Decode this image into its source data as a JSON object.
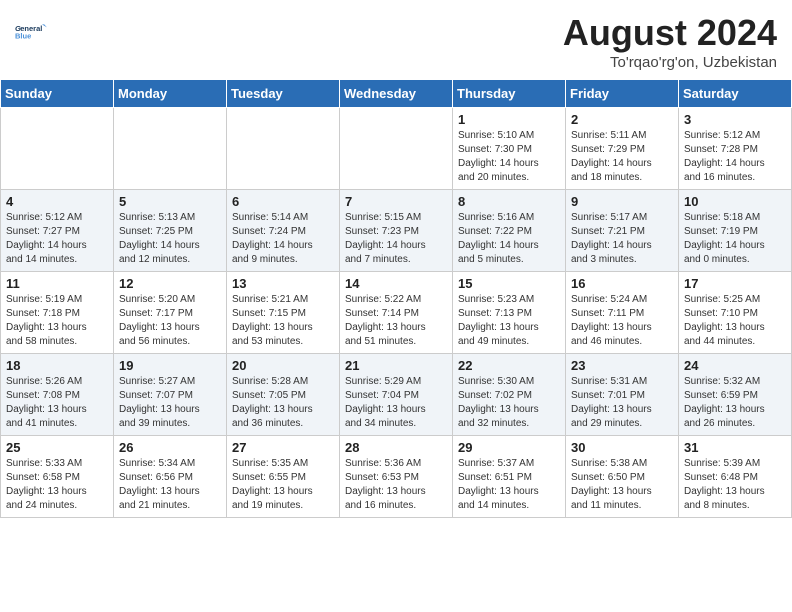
{
  "header": {
    "logo_line1": "General",
    "logo_line2": "Blue",
    "main_title": "August 2024",
    "subtitle": "To'rqao'rg'on, Uzbekistan"
  },
  "weekdays": [
    "Sunday",
    "Monday",
    "Tuesday",
    "Wednesday",
    "Thursday",
    "Friday",
    "Saturday"
  ],
  "weeks": [
    [
      {
        "day": "",
        "info": ""
      },
      {
        "day": "",
        "info": ""
      },
      {
        "day": "",
        "info": ""
      },
      {
        "day": "",
        "info": ""
      },
      {
        "day": "1",
        "info": "Sunrise: 5:10 AM\nSunset: 7:30 PM\nDaylight: 14 hours\nand 20 minutes."
      },
      {
        "day": "2",
        "info": "Sunrise: 5:11 AM\nSunset: 7:29 PM\nDaylight: 14 hours\nand 18 minutes."
      },
      {
        "day": "3",
        "info": "Sunrise: 5:12 AM\nSunset: 7:28 PM\nDaylight: 14 hours\nand 16 minutes."
      }
    ],
    [
      {
        "day": "4",
        "info": "Sunrise: 5:12 AM\nSunset: 7:27 PM\nDaylight: 14 hours\nand 14 minutes."
      },
      {
        "day": "5",
        "info": "Sunrise: 5:13 AM\nSunset: 7:25 PM\nDaylight: 14 hours\nand 12 minutes."
      },
      {
        "day": "6",
        "info": "Sunrise: 5:14 AM\nSunset: 7:24 PM\nDaylight: 14 hours\nand 9 minutes."
      },
      {
        "day": "7",
        "info": "Sunrise: 5:15 AM\nSunset: 7:23 PM\nDaylight: 14 hours\nand 7 minutes."
      },
      {
        "day": "8",
        "info": "Sunrise: 5:16 AM\nSunset: 7:22 PM\nDaylight: 14 hours\nand 5 minutes."
      },
      {
        "day": "9",
        "info": "Sunrise: 5:17 AM\nSunset: 7:21 PM\nDaylight: 14 hours\nand 3 minutes."
      },
      {
        "day": "10",
        "info": "Sunrise: 5:18 AM\nSunset: 7:19 PM\nDaylight: 14 hours\nand 0 minutes."
      }
    ],
    [
      {
        "day": "11",
        "info": "Sunrise: 5:19 AM\nSunset: 7:18 PM\nDaylight: 13 hours\nand 58 minutes."
      },
      {
        "day": "12",
        "info": "Sunrise: 5:20 AM\nSunset: 7:17 PM\nDaylight: 13 hours\nand 56 minutes."
      },
      {
        "day": "13",
        "info": "Sunrise: 5:21 AM\nSunset: 7:15 PM\nDaylight: 13 hours\nand 53 minutes."
      },
      {
        "day": "14",
        "info": "Sunrise: 5:22 AM\nSunset: 7:14 PM\nDaylight: 13 hours\nand 51 minutes."
      },
      {
        "day": "15",
        "info": "Sunrise: 5:23 AM\nSunset: 7:13 PM\nDaylight: 13 hours\nand 49 minutes."
      },
      {
        "day": "16",
        "info": "Sunrise: 5:24 AM\nSunset: 7:11 PM\nDaylight: 13 hours\nand 46 minutes."
      },
      {
        "day": "17",
        "info": "Sunrise: 5:25 AM\nSunset: 7:10 PM\nDaylight: 13 hours\nand 44 minutes."
      }
    ],
    [
      {
        "day": "18",
        "info": "Sunrise: 5:26 AM\nSunset: 7:08 PM\nDaylight: 13 hours\nand 41 minutes."
      },
      {
        "day": "19",
        "info": "Sunrise: 5:27 AM\nSunset: 7:07 PM\nDaylight: 13 hours\nand 39 minutes."
      },
      {
        "day": "20",
        "info": "Sunrise: 5:28 AM\nSunset: 7:05 PM\nDaylight: 13 hours\nand 36 minutes."
      },
      {
        "day": "21",
        "info": "Sunrise: 5:29 AM\nSunset: 7:04 PM\nDaylight: 13 hours\nand 34 minutes."
      },
      {
        "day": "22",
        "info": "Sunrise: 5:30 AM\nSunset: 7:02 PM\nDaylight: 13 hours\nand 32 minutes."
      },
      {
        "day": "23",
        "info": "Sunrise: 5:31 AM\nSunset: 7:01 PM\nDaylight: 13 hours\nand 29 minutes."
      },
      {
        "day": "24",
        "info": "Sunrise: 5:32 AM\nSunset: 6:59 PM\nDaylight: 13 hours\nand 26 minutes."
      }
    ],
    [
      {
        "day": "25",
        "info": "Sunrise: 5:33 AM\nSunset: 6:58 PM\nDaylight: 13 hours\nand 24 minutes."
      },
      {
        "day": "26",
        "info": "Sunrise: 5:34 AM\nSunset: 6:56 PM\nDaylight: 13 hours\nand 21 minutes."
      },
      {
        "day": "27",
        "info": "Sunrise: 5:35 AM\nSunset: 6:55 PM\nDaylight: 13 hours\nand 19 minutes."
      },
      {
        "day": "28",
        "info": "Sunrise: 5:36 AM\nSunset: 6:53 PM\nDaylight: 13 hours\nand 16 minutes."
      },
      {
        "day": "29",
        "info": "Sunrise: 5:37 AM\nSunset: 6:51 PM\nDaylight: 13 hours\nand 14 minutes."
      },
      {
        "day": "30",
        "info": "Sunrise: 5:38 AM\nSunset: 6:50 PM\nDaylight: 13 hours\nand 11 minutes."
      },
      {
        "day": "31",
        "info": "Sunrise: 5:39 AM\nSunset: 6:48 PM\nDaylight: 13 hours\nand 8 minutes."
      }
    ]
  ]
}
